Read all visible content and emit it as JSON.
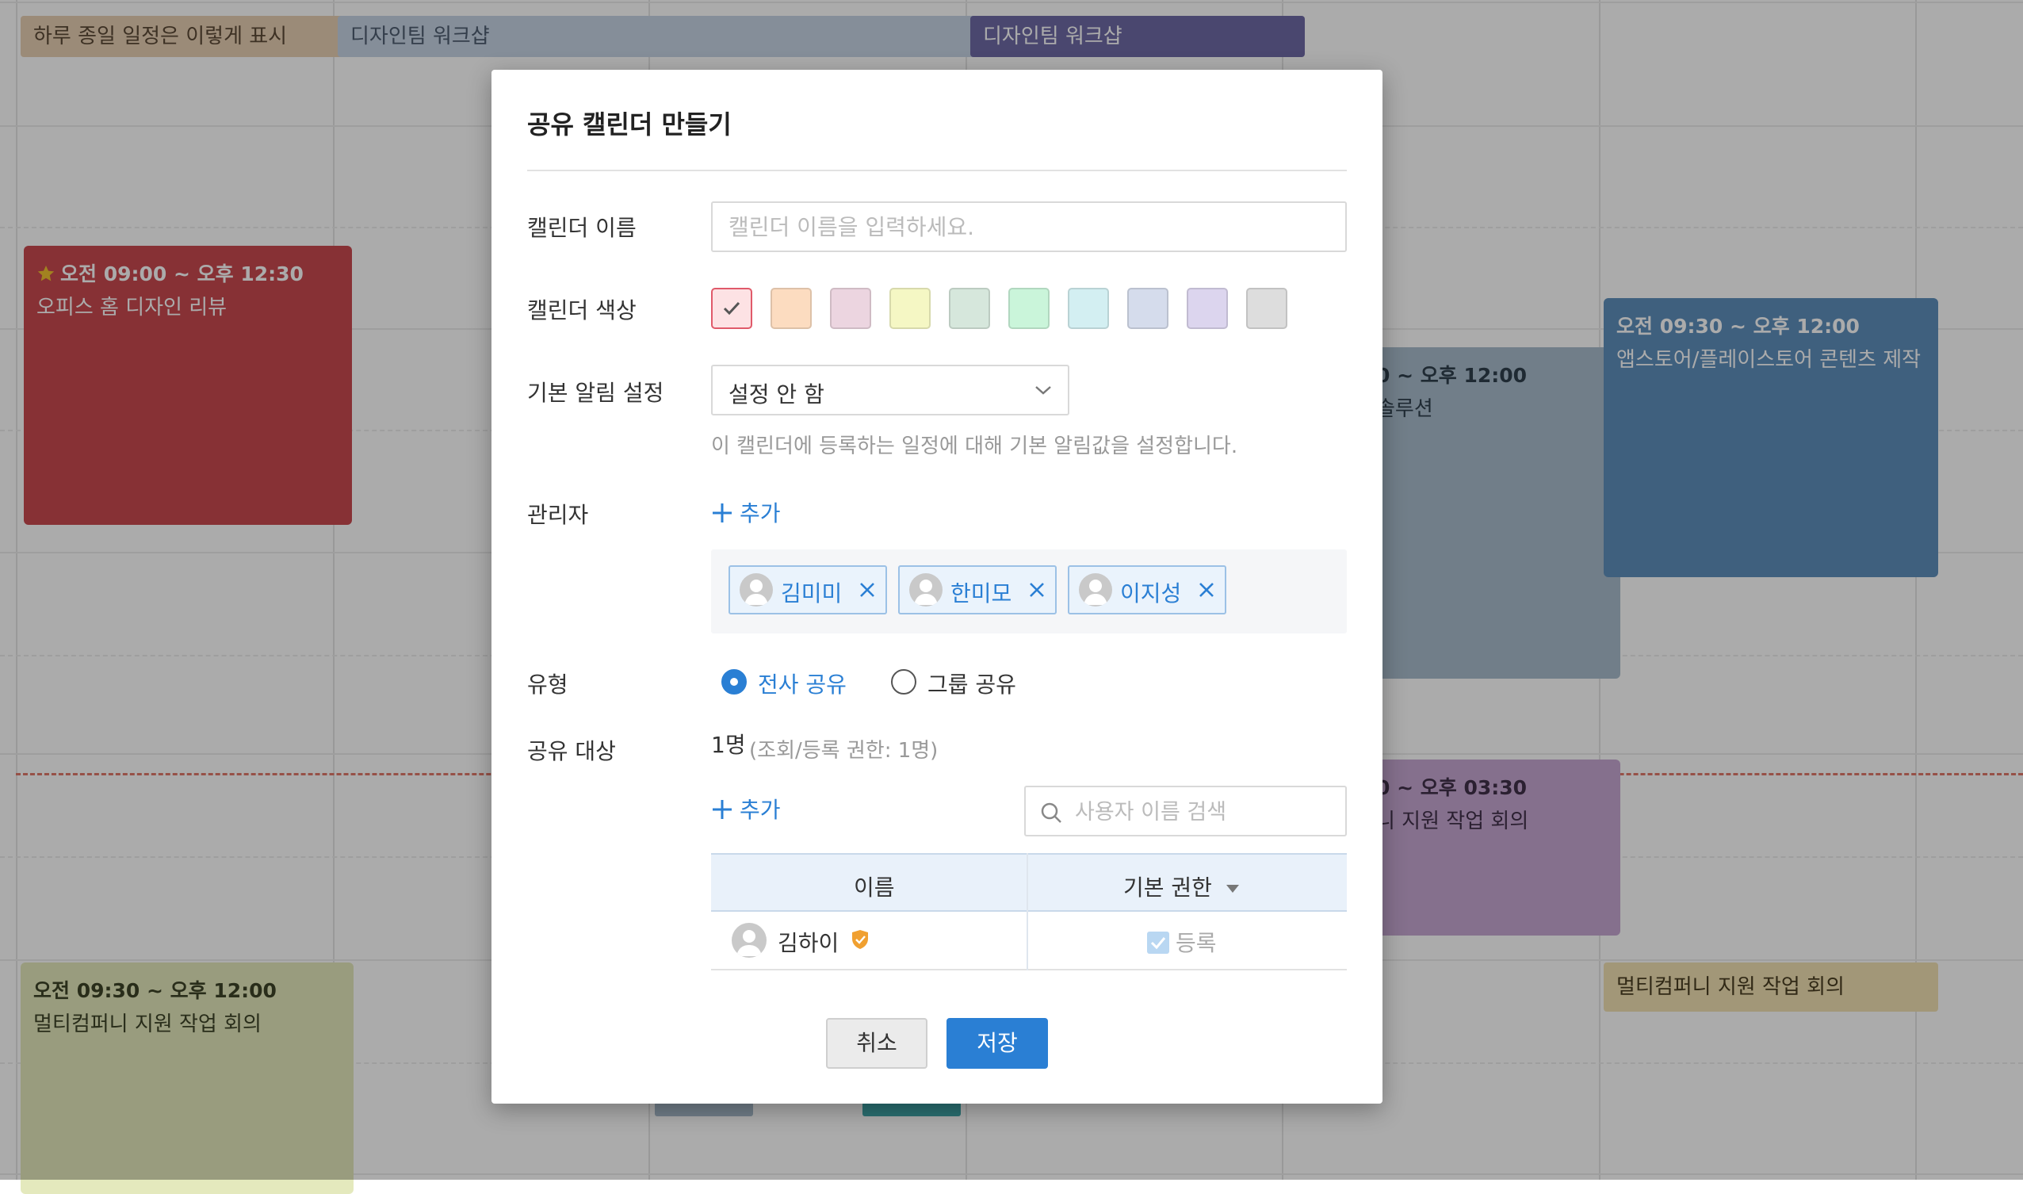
{
  "calendar": {
    "allday": {
      "chip1": "하루 종일 일정은 이렇게 표시",
      "chip2": "디자인팀 워크샵",
      "chip3": "디자인팀 워크샵"
    },
    "events": {
      "e1_time": "오전 09:00 ~ 오후 12:30",
      "e1_title": "오피스 홈 디자인 리뷰",
      "e2_time": "오전 09:30 ~ 오후 12:00",
      "e2_title": "멀티컴퍼니 지원 작업 회의",
      "e3_time": "0 ~ 오후 12:00",
      "e3_title": "솔루션",
      "e4_time": "0 ~ 오후 03:30",
      "e4_title": "니 지원 작업 회의",
      "e5_time": "오전 09:30 ~ 오후 12:00",
      "e5_title": "앱스토어/플레이스토어 콘텐츠 제작",
      "e6_title": "멀티컴퍼니 지원 작업 회의"
    },
    "colors": {
      "allday1": "#e8cfb4",
      "allday2": "#c7d4e5",
      "allday3": "#6f6aa6",
      "red_event": "#c94a4f",
      "green_event": "#e4e9bd",
      "gray_blue_event": "#a9bdcc",
      "purple_event": "#c7a7d3",
      "blue_event": "#5f8fbd",
      "yellow_event": "#f2e2b4"
    }
  },
  "modal": {
    "title": "공유 캘린더 만들기",
    "labels": {
      "name": "캘린더 이름",
      "color": "캘린더 색상",
      "alarm": "기본 알림 설정",
      "admin": "관리자",
      "type": "유형",
      "share_target": "공유 대상"
    },
    "name_placeholder": "캘린더 이름을 입력하세요.",
    "swatches": [
      "#fde2e4",
      "#fcdcc0",
      "#ecd5e0",
      "#f5f7c4",
      "#d6e7dc",
      "#caf5da",
      "#d3eff2",
      "#d5dcec",
      "#dcd5ee",
      "#dddddd"
    ],
    "selected_swatch_index": 0,
    "alarm": {
      "value": "설정 안 함",
      "help": "이 캘린더에 등록하는 일정에 대해 기본 알림값을 설정합니다."
    },
    "add_label": "추가",
    "admins": [
      "김미미",
      "한미모",
      "이지성"
    ],
    "type_options": {
      "company": "전사 공유",
      "group": "그룹 공유",
      "selected": "전사 공유"
    },
    "share": {
      "count": "1명",
      "note": "(조회/등록 권한: 1명)",
      "add_label": "추가",
      "search_placeholder": "사용자 이름 검색",
      "table": {
        "col_name": "이름",
        "col_perm": "기본 권한",
        "rows": [
          {
            "name": "김하이",
            "perm": "등록"
          }
        ]
      }
    },
    "buttons": {
      "cancel": "취소",
      "save": "저장"
    },
    "accent": "#2a7fd4"
  }
}
